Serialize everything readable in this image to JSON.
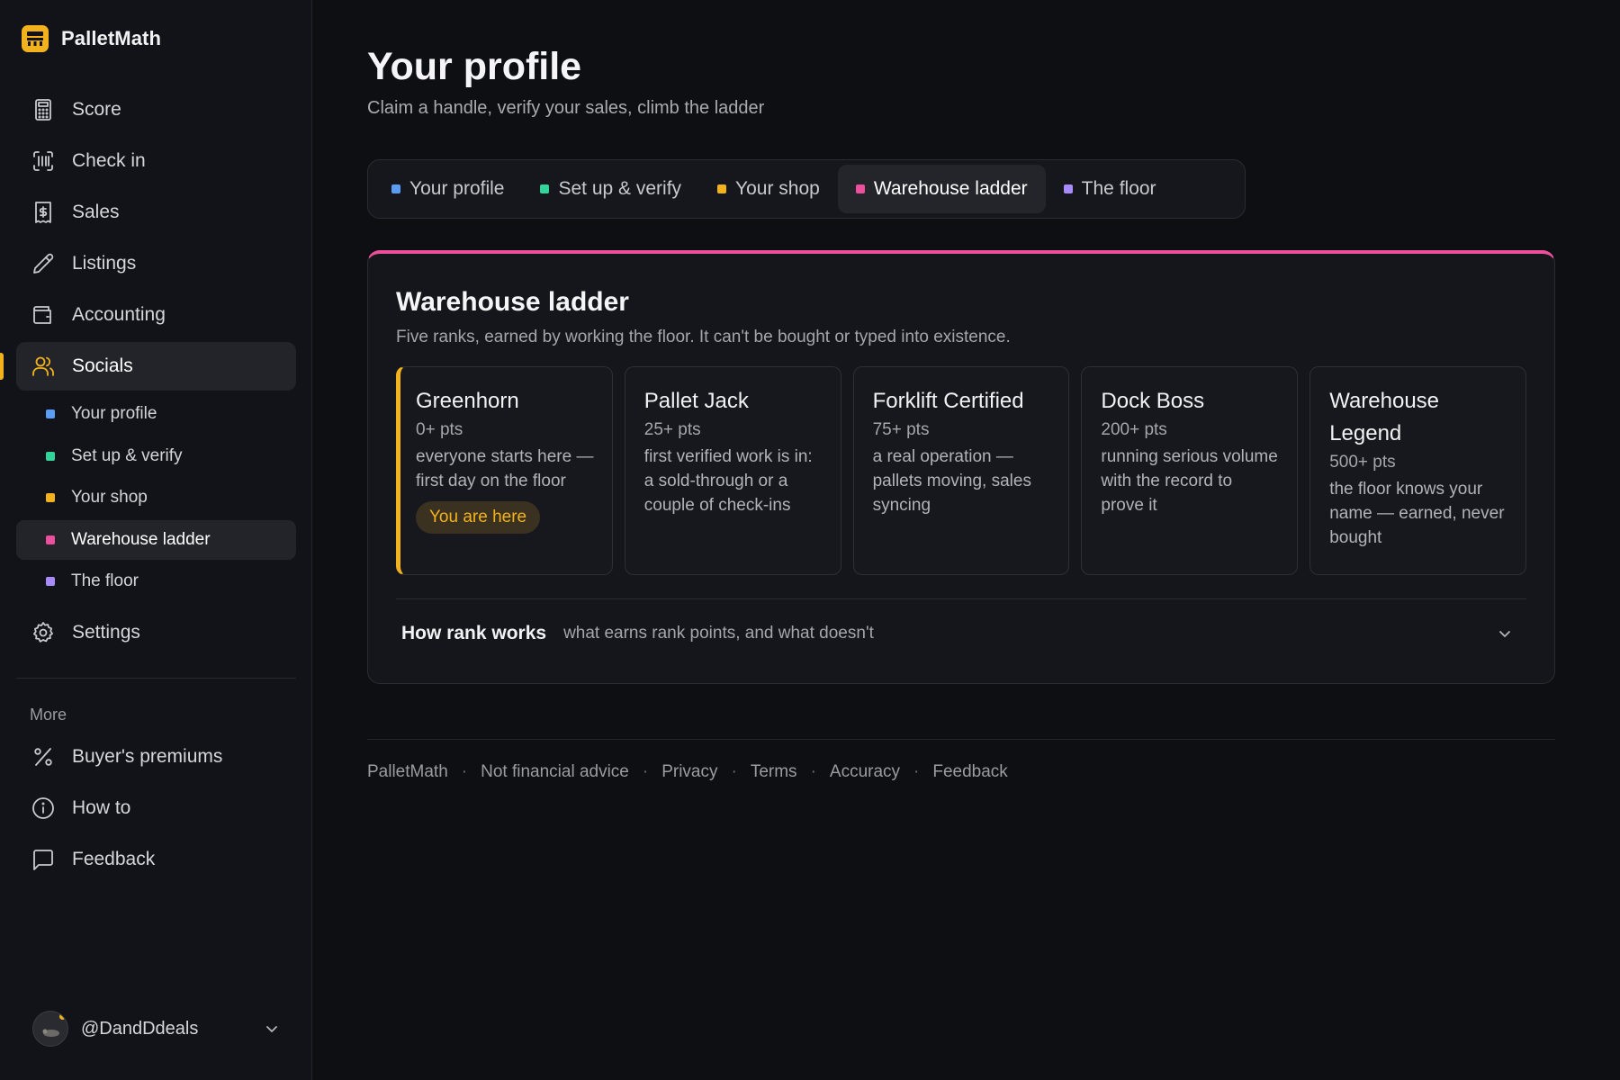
{
  "app": {
    "name": "PalletMath"
  },
  "sidebar": {
    "nav": [
      {
        "label": "Score",
        "icon": "calculator-icon"
      },
      {
        "label": "Check in",
        "icon": "scan-barcode-icon"
      },
      {
        "label": "Sales",
        "icon": "receipt-dollar-icon"
      },
      {
        "label": "Listings",
        "icon": "pencil-icon"
      },
      {
        "label": "Accounting",
        "icon": "wallet-icon"
      },
      {
        "label": "Socials",
        "icon": "users-icon"
      }
    ],
    "subnav": [
      {
        "label": "Your profile",
        "color": "#5b9df5"
      },
      {
        "label": "Set up & verify",
        "color": "#34d399"
      },
      {
        "label": "Your shop",
        "color": "#f2b21d"
      },
      {
        "label": "Warehouse ladder",
        "color": "#ec4f9c"
      },
      {
        "label": "The floor",
        "color": "#a78bfa"
      }
    ],
    "settings": {
      "label": "Settings",
      "icon": "gear-icon"
    },
    "more_label": "More",
    "more": [
      {
        "label": "Buyer's premiums",
        "icon": "percent-icon"
      },
      {
        "label": "How to",
        "icon": "info-icon"
      },
      {
        "label": "Feedback",
        "icon": "message-icon"
      }
    ],
    "user": {
      "handle": "@DandDdeals"
    }
  },
  "page": {
    "title": "Your profile",
    "subtitle": "Claim a handle, verify your sales, climb the ladder"
  },
  "tabs": [
    {
      "label": "Your profile",
      "color": "#5b9df5"
    },
    {
      "label": "Set up & verify",
      "color": "#34d399"
    },
    {
      "label": "Your shop",
      "color": "#f2b21d"
    },
    {
      "label": "Warehouse ladder",
      "color": "#ec4f9c"
    },
    {
      "label": "The floor",
      "color": "#a78bfa"
    }
  ],
  "ladder": {
    "title": "Warehouse ladder",
    "description": "Five ranks, earned by working the floor. It can't be bought or typed into existence.",
    "ranks": [
      {
        "name": "Greenhorn",
        "pts": "0+ pts",
        "desc": "everyone starts here — first day on the floor",
        "badge": "You are here"
      },
      {
        "name": "Pallet Jack",
        "pts": "25+ pts",
        "desc": "first verified work is in: a sold-through or a couple of check-ins"
      },
      {
        "name": "Forklift Certified",
        "pts": "75+ pts",
        "desc": "a real operation — pallets moving, sales syncing"
      },
      {
        "name": "Dock Boss",
        "pts": "200+ pts",
        "desc": "running serious volume with the record to prove it"
      },
      {
        "name": "Warehouse Legend",
        "pts": "500+ pts",
        "desc": "the floor knows your name — earned, never bought"
      }
    ],
    "how": {
      "title": "How rank works",
      "subtitle": "what earns rank points, and what doesn't"
    }
  },
  "footer": {
    "brand": "PalletMath",
    "links": [
      "Not financial advice",
      "Privacy",
      "Terms",
      "Accuracy",
      "Feedback"
    ],
    "separator": "·"
  },
  "colors": {
    "accent": "#f2b21d",
    "ladder": "#ec4f9c"
  }
}
